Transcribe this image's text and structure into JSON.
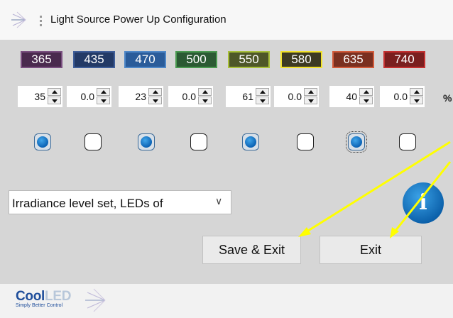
{
  "window": {
    "title": "Light Source Power Up Configuration"
  },
  "wavelengths": [
    {
      "label": "365",
      "bg": "#4a2a4e",
      "border": "#7a4f80"
    },
    {
      "label": "435",
      "bg": "#233a66",
      "border": "#3f5e99"
    },
    {
      "label": "470",
      "bg": "#2a5c9a",
      "border": "#4f88c8"
    },
    {
      "label": "500",
      "bg": "#2b5a33",
      "border": "#4a9a50"
    },
    {
      "label": "550",
      "bg": "#4e5728",
      "border": "#a8c03a"
    },
    {
      "label": "580",
      "bg": "#3d3a22",
      "border": "#f2e22a"
    },
    {
      "label": "635",
      "bg": "#7a3020",
      "border": "#d25a3a"
    },
    {
      "label": "740",
      "bg": "#7a1f1f",
      "border": "#c43030"
    }
  ],
  "levels": [
    "35",
    "0.0",
    "23",
    "0.0",
    "61",
    "0.0",
    "40",
    "0.0"
  ],
  "percent_symbol": "%",
  "enabled": [
    true,
    false,
    true,
    false,
    true,
    false,
    true,
    false
  ],
  "dropdown": {
    "value": "Irradiance level set, LEDs of"
  },
  "info_icon": "i",
  "buttons": {
    "save_exit": "Save & Exit",
    "exit": "Exit"
  },
  "footer": {
    "logo_main_a": "Cool",
    "logo_main_b": "LED",
    "logo_tagline": "Simply Better Control"
  },
  "colors": {
    "highlight_arrow": "#ffff00",
    "checkbox_on": "#0b62b4"
  }
}
